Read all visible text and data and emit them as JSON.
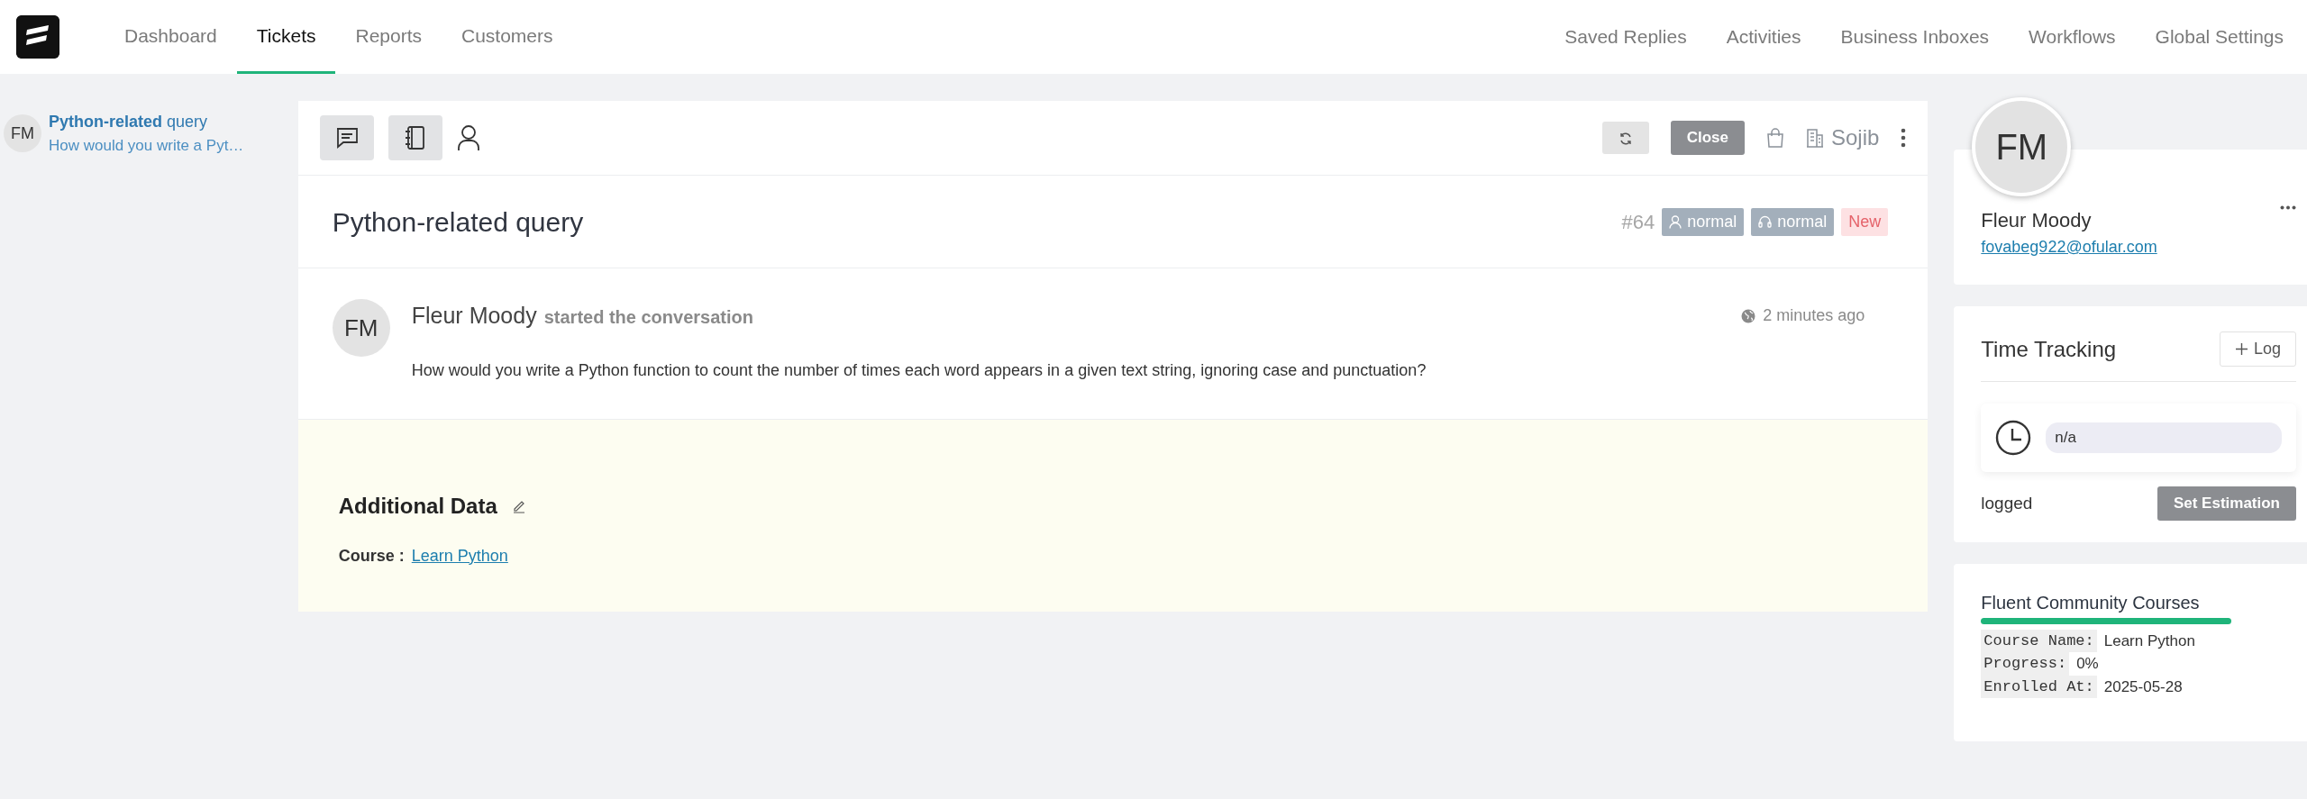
{
  "nav": {
    "left": [
      {
        "label": "Dashboard",
        "selected": false
      },
      {
        "label": "Tickets",
        "selected": true
      },
      {
        "label": "Reports",
        "selected": false
      },
      {
        "label": "Customers",
        "selected": false
      }
    ],
    "right": [
      "Saved Replies",
      "Activities",
      "Business Inboxes",
      "Workflows",
      "Global Settings"
    ]
  },
  "ticket_list": [
    {
      "initials": "FM",
      "title": "**Python-related** query",
      "preview": "How would you write a Pyt…"
    }
  ],
  "toolbar": {
    "close_label": "Close",
    "agent": "Sojib"
  },
  "ticket": {
    "title": "Python-related query",
    "number": "#64",
    "tags": [
      {
        "kind": "person",
        "label": "normal"
      },
      {
        "kind": "headset",
        "label": "normal"
      },
      {
        "kind": "status",
        "label": "New"
      }
    ]
  },
  "conversation": {
    "initials": "FM",
    "author": "Fleur Moody",
    "action": "started the conversation",
    "time": "2 minutes ago",
    "body": "How would you write a Python function to count the number of times each word appears in a given text string, ignoring case and punctuation?"
  },
  "additional_data": {
    "title": "Additional Data",
    "fields": [
      {
        "label": "Course :",
        "value": "Learn Python"
      }
    ]
  },
  "contact": {
    "initials": "FM",
    "name": "Fleur Moody",
    "email": "fovabeg922@ofular.com"
  },
  "time_tracking": {
    "title": "Time Tracking",
    "log_label": "Log",
    "value": "n/a",
    "logged_label": "logged",
    "estimation_label": "Set Estimation"
  },
  "courses": {
    "title": "Fluent Community Courses",
    "rows": [
      {
        "label": "Course Name:",
        "value": "Learn Python"
      },
      {
        "label": "Progress:",
        "value": "0%"
      },
      {
        "label": "Enrolled At:",
        "value": "2025-05-28"
      }
    ]
  }
}
